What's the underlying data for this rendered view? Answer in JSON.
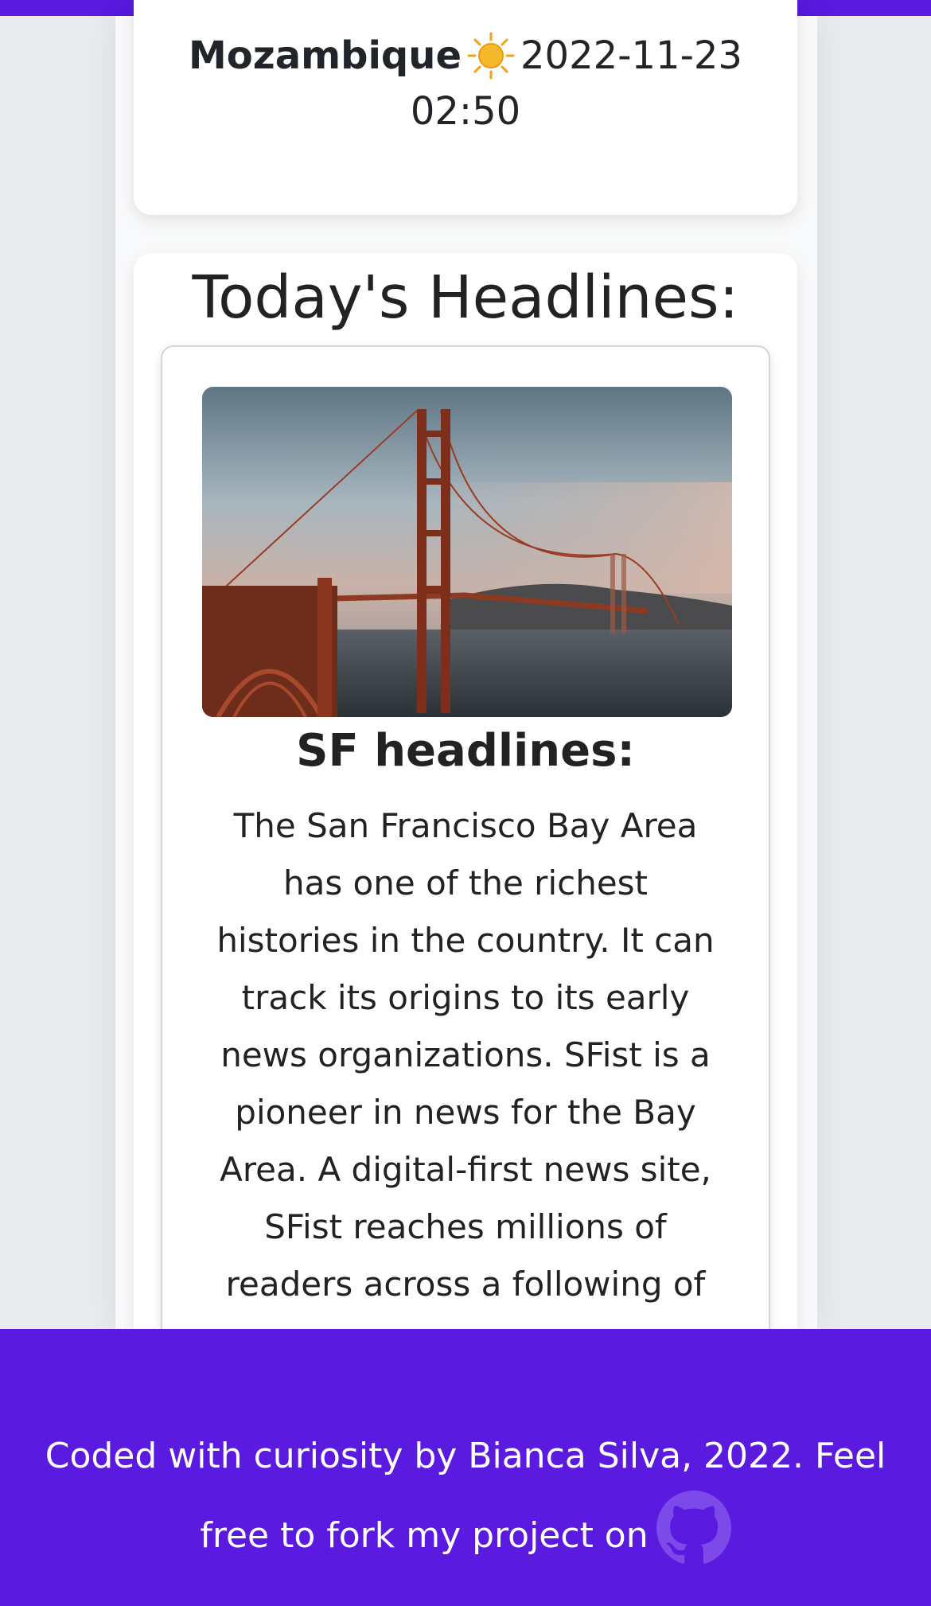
{
  "location": {
    "country": "Mozambique",
    "weather_icon": "sun-icon",
    "date": "2022-11-23",
    "time": "02:50"
  },
  "headlines": {
    "title": "Today's Headlines:",
    "article": {
      "image_icon": "golden-gate-bridge-image",
      "heading": "SF headlines:",
      "body": "The San Francisco Bay Area has one of the richest histories in the country. It can track its origins to its early news organizations. SFist is a pioneer in news for the Bay Area. A digital-first news site, SFist reaches millions of readers across a following of"
    }
  },
  "footer": {
    "line1": "Coded with curiosity by Bianca Silva, 2022. Feel",
    "line2": "free to fork my project on",
    "link_icon": "github-icon"
  },
  "colors": {
    "accent": "#5a1adf",
    "background": "#e9ebee",
    "card": "#ffffff",
    "text": "#212529"
  }
}
